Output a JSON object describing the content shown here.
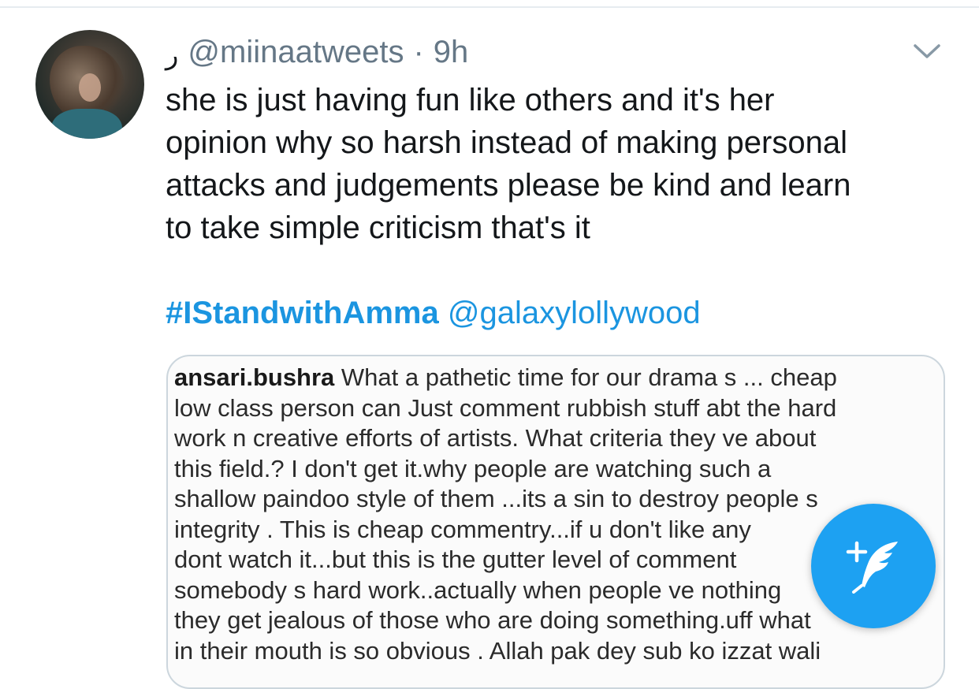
{
  "tweet": {
    "display_name_glyph": "ر",
    "handle": "@miinaatweets",
    "separator": "·",
    "time": "9h",
    "text_lines": [
      "she is just having fun like others and it's her",
      "opinion why so harsh  instead of making personal",
      "attacks and judgements please be kind and learn",
      "to take simple criticism that's it"
    ],
    "hashtag": "#IStandwithAmma",
    "mention": "@galaxylollywood"
  },
  "embedded_image": {
    "username": "ansari.bushra",
    "lines": [
      " What a pathetic time for our drama s ... cheap",
      "low class  person can Just comment  rubbish stuff abt the hard",
      "work n creative efforts of artists. What criteria they ve about",
      "this field.? I don't get it.why  people are watching  such a",
      "shallow  paindoo style of  them ...its a sin to destroy people s",
      "integrity . This is cheap commentry...if u don't like any",
      "dont watch it...but this is the gutter level of comment",
      "somebody s hard  work..actually when people ve nothing",
      "they get jealous  of those who are doing something.uff what",
      "in their mouth is so obvious . Allah pak dey sub ko izzat wali"
    ]
  },
  "icons": {
    "chevron": "chevron-down-icon",
    "compose": "compose-tweet-icon"
  },
  "colors": {
    "link_blue": "#1b95e0",
    "fab_blue": "#1da1f2",
    "meta_gray": "#657786"
  }
}
